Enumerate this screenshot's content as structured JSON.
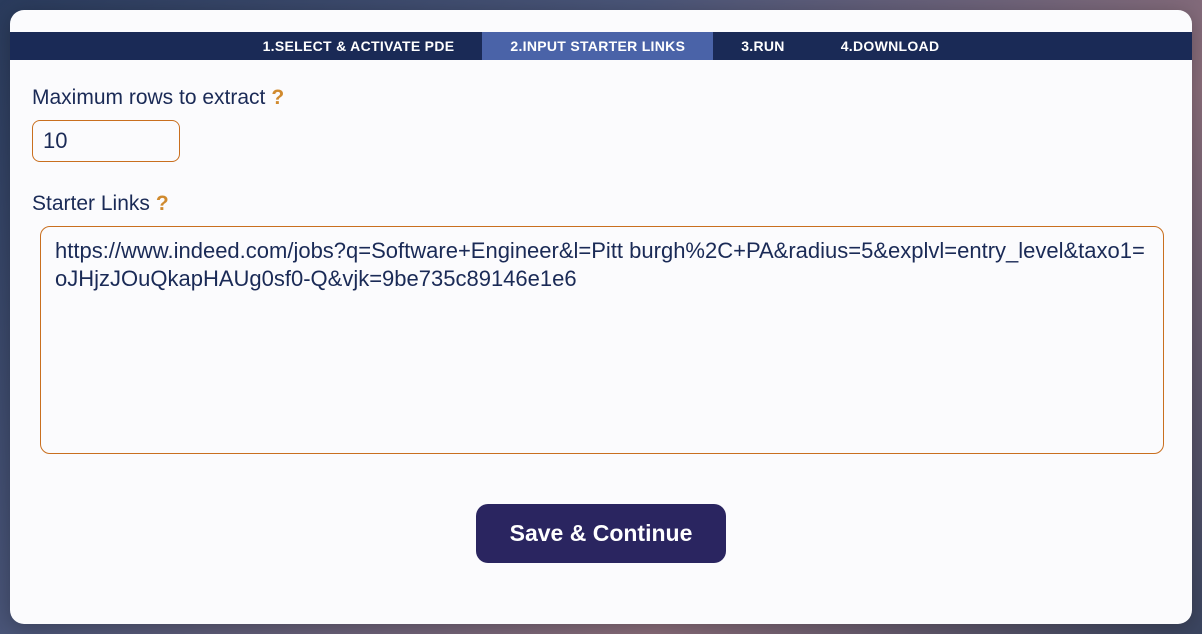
{
  "tabs": [
    {
      "label": "1.SELECT & ACTIVATE PDE",
      "active": false
    },
    {
      "label": "2.INPUT STARTER LINKS",
      "active": true
    },
    {
      "label": "3.RUN",
      "active": false
    },
    {
      "label": "4.DOWNLOAD",
      "active": false
    }
  ],
  "form": {
    "max_rows_label": "Maximum rows to extract",
    "max_rows_help": "?",
    "max_rows_value": "10",
    "starter_links_label": "Starter Links",
    "starter_links_help": "?",
    "starter_links_value": "https://www.indeed.com/jobs?q=Software+Engineer&l=Pitt burgh%2C+PA&radius=5&explvl=entry_level&taxo1=oJHjzJOuQkapHAUg0sf0-Q&vjk=9be735c89146e1e6"
  },
  "actions": {
    "save_continue_label": "Save & Continue"
  }
}
